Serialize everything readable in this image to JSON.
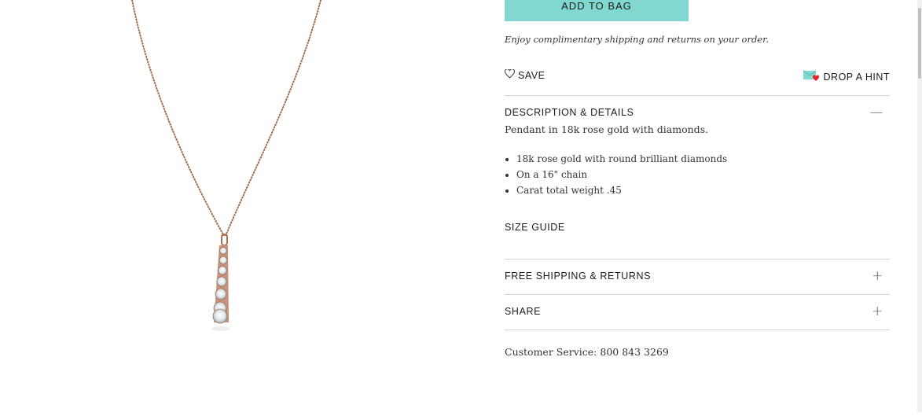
{
  "product": {
    "add_to_bag_label": "ADD TO BAG",
    "shipping_note": "Enjoy complimentary shipping and returns on your order.",
    "metal_color": "#b07a5c",
    "accent_color": "#81d8d0"
  },
  "actions": {
    "save_label": "SAVE",
    "save_icon": "heart-outline-icon",
    "hint_label": "DROP A HINT",
    "hint_icon": "envelope-heart-icon"
  },
  "description": {
    "header": "DESCRIPTION & DETAILS",
    "toggle": "—",
    "text": "Pendant in 18k rose gold with diamonds.",
    "bullets": [
      "18k rose gold with round brilliant diamonds",
      "On a 16\" chain",
      "Carat total weight .45"
    ]
  },
  "size_guide_label": "SIZE GUIDE",
  "sections": [
    {
      "label": "FREE SHIPPING & RETURNS",
      "toggle": "+"
    },
    {
      "label": "SHARE",
      "toggle": "+"
    }
  ],
  "customer_service": {
    "label": "Customer Service:",
    "phone": "800 843 3269"
  }
}
